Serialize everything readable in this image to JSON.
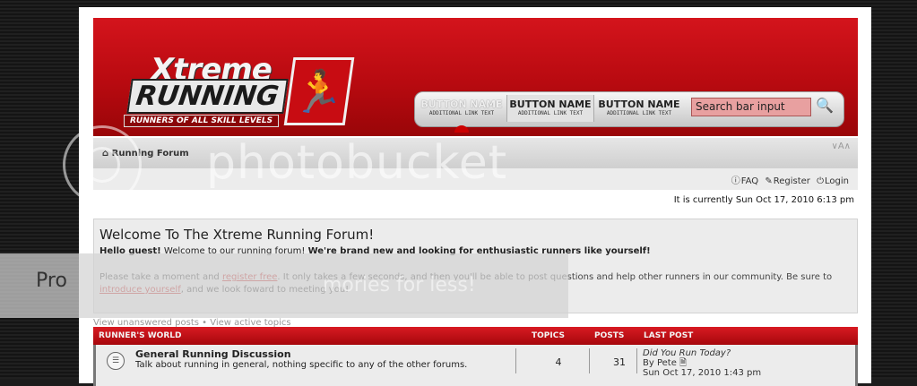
{
  "site": {
    "logo_word1": "Xtreme",
    "logo_word2": "RUNNING",
    "logo_tagline": "RUNNERS OF ALL SKILL LEVELS"
  },
  "nav": {
    "buttons": [
      {
        "name": "BUTTON NAME",
        "sub": "ADDITIONAL LINK TEXT"
      },
      {
        "name": "BUTTON NAME",
        "sub": "ADDITIONAL LINK TEXT"
      },
      {
        "name": "BUTTON NAME",
        "sub": "ADDITIONAL LINK TEXT"
      }
    ],
    "search_text": "Search bar input"
  },
  "breadcrumb": {
    "home_icon": "home-icon",
    "label": "Running Forum",
    "font_resize": "∨A∧"
  },
  "toplinks": {
    "faq": "FAQ",
    "register": "Register",
    "login": "Login"
  },
  "currently": "It is currently Sun Oct 17, 2010 6:13 pm",
  "welcome": {
    "title": "Welcome To The Xtreme Running Forum!",
    "hello_bold": "Hello guest!",
    "hello_text": " Welcome to our running forum! ",
    "hello_bold2": "We're brand new and looking for enthusiastic runners like yourself!",
    "para_a": "Please take a moment and ",
    "register_link": "register free",
    "para_b": ". It only takes a few seconds, and then you'll be able to post questions and help other runners in our community. Be sure to ",
    "introduce_link": "introduce yourself",
    "para_c": ", and we look foward to meeting you!"
  },
  "below_links": "View unanswered posts • View active topics",
  "forum": {
    "section": "RUNNER'S WORLD",
    "col_topics": "TOPICS",
    "col_posts": "POSTS",
    "col_last": "LAST POST",
    "rows": [
      {
        "title": "General Running Discussion",
        "desc": "Talk about running in general, nothing specific to any of the other forums.",
        "topics": "4",
        "posts": "31",
        "last_title": "Did You Run Today?",
        "last_by": "By Pete",
        "last_date": "Sun Oct 17, 2010 1:43 pm"
      }
    ]
  },
  "watermark": {
    "brand": "photobucket",
    "promo_left": "Pro",
    "promo_right": "mories for less!"
  }
}
